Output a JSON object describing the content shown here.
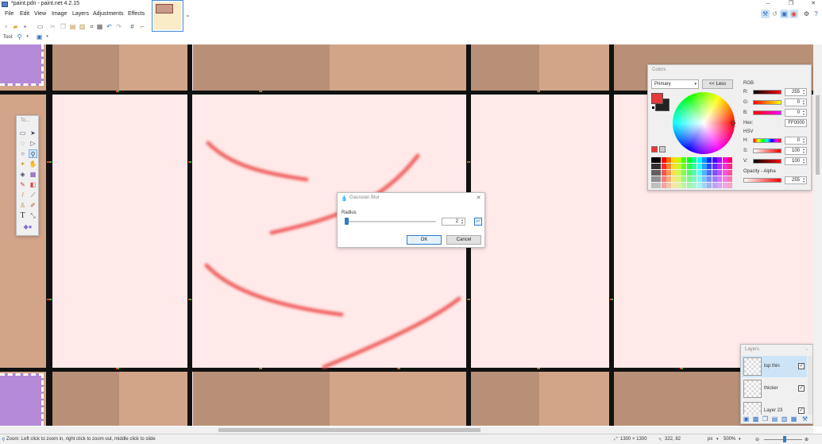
{
  "window": {
    "title": "*paint.pdn - paint.net 4.2.15",
    "min_glyph": "–",
    "max_glyph": "❐",
    "close_glyph": "✕"
  },
  "menu": [
    "File",
    "Edit",
    "View",
    "Image",
    "Layers",
    "Adjustments",
    "Effects"
  ],
  "toolbar": {
    "tool_label": "Tool:",
    "icons": [
      "new-icon",
      "open-icon",
      "save-icon",
      "print-icon",
      "cut-icon",
      "copy-icon",
      "paste-icon",
      "paste-new-icon",
      "crop-icon",
      "deselect-icon",
      "undo-icon",
      "redo-icon",
      "grid-icon",
      "ruler-icon"
    ]
  },
  "tools_window": {
    "title": "To...",
    "tools": [
      "rectangle-select-icon",
      "move-selection-icon",
      "lasso-select-icon",
      "move-selected-icon",
      "ellipse-select-icon",
      "zoom-icon",
      "magic-wand-icon",
      "pan-icon",
      "paint-bucket-icon",
      "gradient-icon",
      "paintbrush-icon",
      "eraser-icon",
      "pencil-icon",
      "color-picker-icon",
      "clone-stamp-icon",
      "recolor-icon",
      "text-icon",
      "line-curve-icon",
      "shapes-icon"
    ],
    "selected": "zoom-icon"
  },
  "colors_window": {
    "title": "Colors",
    "mode": "Primary",
    "less_button": "<< Less",
    "primary_color": "#e8393a",
    "secondary_color": "#222222",
    "rgb_label": "RGB",
    "r_label": "R:",
    "g_label": "G:",
    "b_label": "B:",
    "r": "255",
    "g": "0",
    "b": "0",
    "hex_label": "Hex:",
    "hex": "FF0000",
    "hsv_label": "HSV",
    "h_label": "H:",
    "s_label": "S:",
    "v_label": "V:",
    "h": "0",
    "s": "100",
    "v": "100",
    "opacity_label": "Opacity - Alpha",
    "alpha": "255"
  },
  "blur_dialog": {
    "title": "Gaussian Blur",
    "radius_label": "Radius",
    "radius_value": "2",
    "ok": "OK",
    "cancel": "Cancel"
  },
  "layers_window": {
    "title": "Layers",
    "layers": [
      {
        "name": "top thin",
        "selected": true,
        "visible": true
      },
      {
        "name": "thicker",
        "selected": false,
        "visible": true
      },
      {
        "name": "Layer 23",
        "selected": false,
        "visible": true
      }
    ]
  },
  "status": {
    "hint": "Zoom: Left click to zoom in, right click to zoom out, middle click to slide",
    "image_size": "1300 × 1300",
    "cursor": "322, 82",
    "units": "px",
    "zoom": "500%"
  }
}
